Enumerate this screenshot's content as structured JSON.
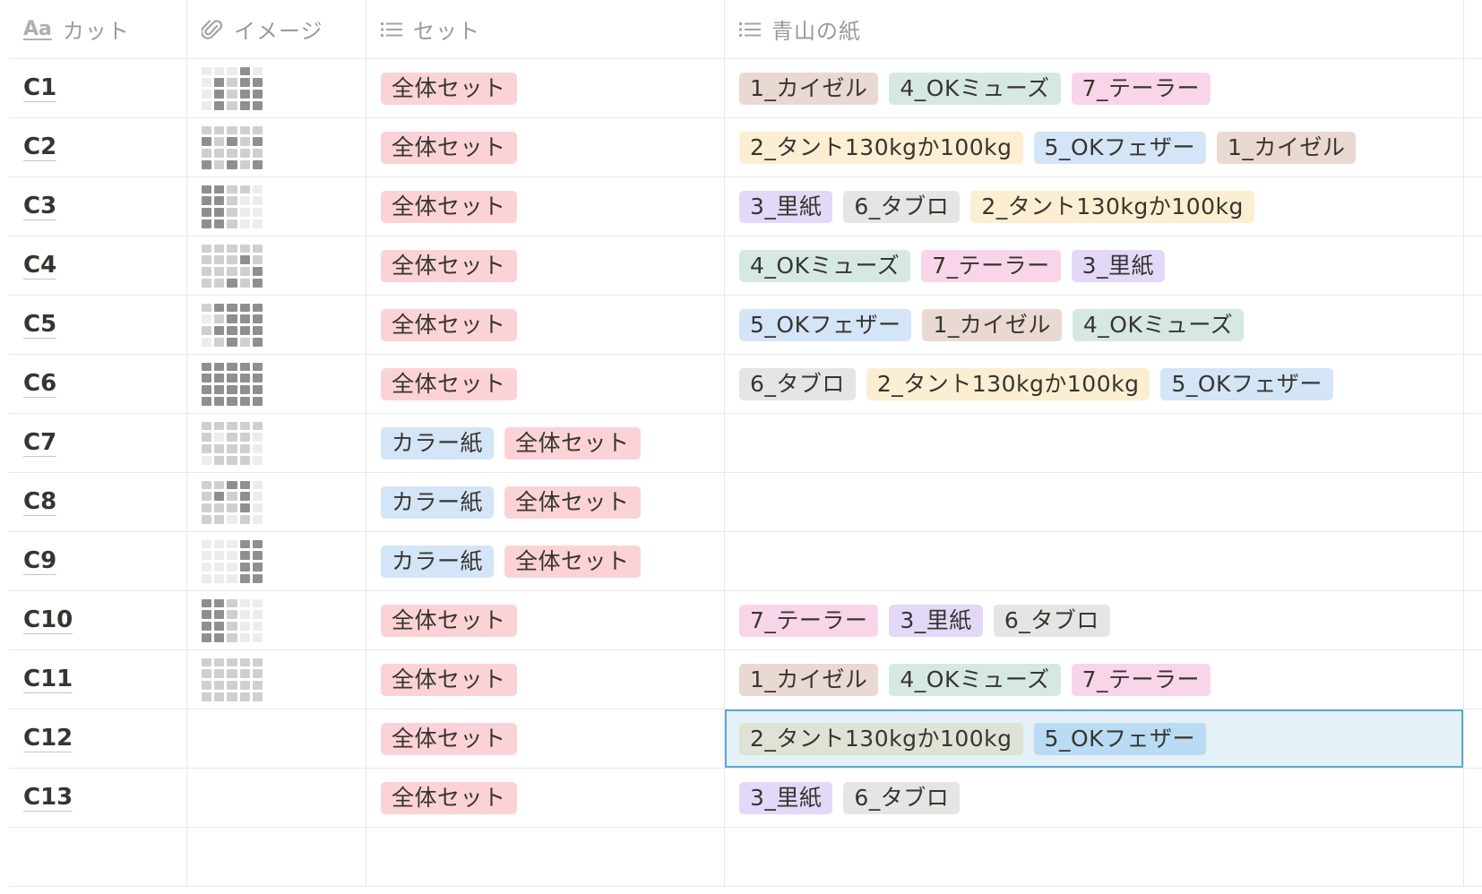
{
  "columns": {
    "name": {
      "label": "カット",
      "icon": "text-property-icon"
    },
    "image": {
      "label": "イメージ",
      "icon": "paperclip-icon"
    },
    "set": {
      "label": "セット",
      "icon": "list-icon"
    },
    "paper": {
      "label": "青山の紙",
      "icon": "list-icon"
    }
  },
  "tag_colors": {
    "全体セット": "#fbd3d6",
    "カラー紙": "#d3e5f7",
    "1_カイゼル": "#e9d9d2",
    "2_タント130kgか100kg": "#fbeed2",
    "3_里紙": "#e3d8f7",
    "4_OKミューズ": "#d5e9e2",
    "5_OKフェザー": "#d3e5f7",
    "6_タブロ": "#e5e5e3",
    "7_テーラー": "#f9d5ea"
  },
  "rows": [
    {
      "name": "C1",
      "thumb": "a",
      "set": [
        "全体セット"
      ],
      "paper": [
        "1_カイゼル",
        "4_OKミューズ",
        "7_テーラー"
      ]
    },
    {
      "name": "C2",
      "thumb": "b",
      "set": [
        "全体セット"
      ],
      "paper": [
        "2_タント130kgか100kg",
        "5_OKフェザー",
        "1_カイゼル"
      ]
    },
    {
      "name": "C3",
      "thumb": "c",
      "set": [
        "全体セット"
      ],
      "paper": [
        "3_里紙",
        "6_タブロ",
        "2_タント130kgか100kg"
      ]
    },
    {
      "name": "C4",
      "thumb": "d",
      "set": [
        "全体セット"
      ],
      "paper": [
        "4_OKミューズ",
        "7_テーラー",
        "3_里紙"
      ]
    },
    {
      "name": "C5",
      "thumb": "e",
      "set": [
        "全体セット"
      ],
      "paper": [
        "5_OKフェザー",
        "1_カイゼル",
        "4_OKミューズ"
      ]
    },
    {
      "name": "C6",
      "thumb": "f",
      "set": [
        "全体セット"
      ],
      "paper": [
        "6_タブロ",
        "2_タント130kgか100kg",
        "5_OKフェザー"
      ]
    },
    {
      "name": "C7",
      "thumb": "g",
      "set": [
        "カラー紙",
        "全体セット"
      ],
      "paper": []
    },
    {
      "name": "C8",
      "thumb": "h",
      "set": [
        "カラー紙",
        "全体セット"
      ],
      "paper": []
    },
    {
      "name": "C9",
      "thumb": "i",
      "set": [
        "カラー紙",
        "全体セット"
      ],
      "paper": []
    },
    {
      "name": "C10",
      "thumb": "j",
      "set": [
        "全体セット"
      ],
      "paper": [
        "7_テーラー",
        "3_里紙",
        "6_タブロ"
      ]
    },
    {
      "name": "C11",
      "thumb": "k",
      "set": [
        "全体セット"
      ],
      "paper": [
        "1_カイゼル",
        "4_OKミューズ",
        "7_テーラー"
      ]
    },
    {
      "name": "C12",
      "thumb": "",
      "set": [
        "全体セット"
      ],
      "paper": [
        "2_タント130kgか100kg",
        "5_OKフェザー"
      ],
      "selected": true
    },
    {
      "name": "C13",
      "thumb": "",
      "set": [
        "全体セット"
      ],
      "paper": [
        "3_里紙",
        "6_タブロ"
      ]
    }
  ]
}
